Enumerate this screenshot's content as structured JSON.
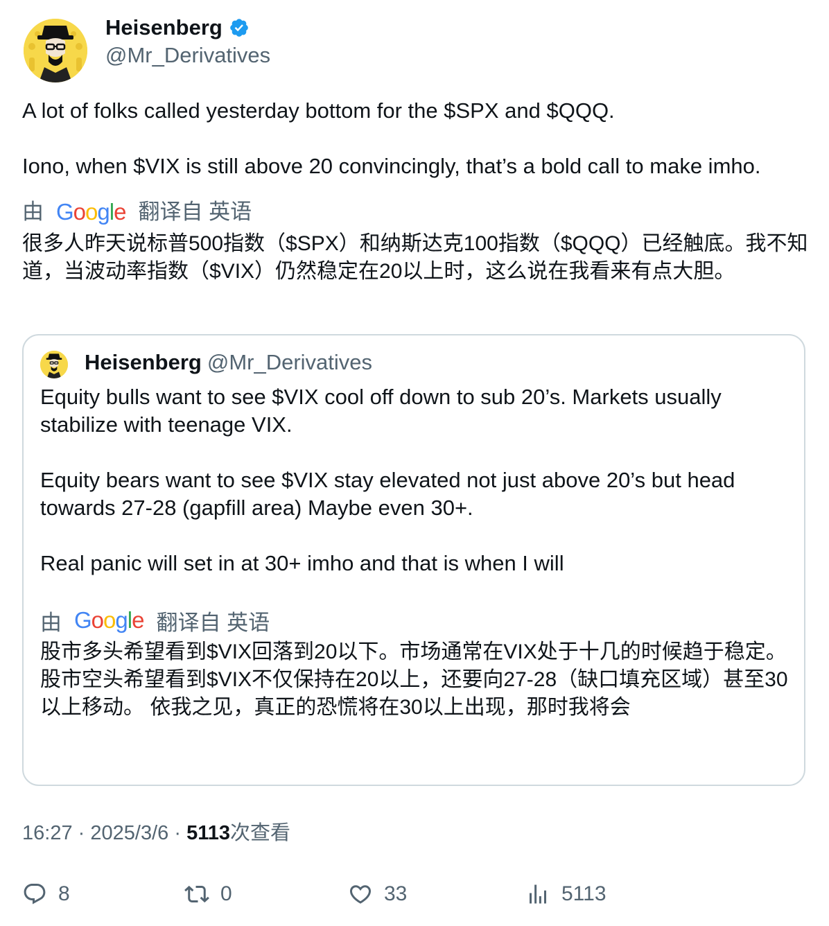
{
  "author": {
    "name": "Heisenberg",
    "handle": "@Mr_Derivatives",
    "verified": true
  },
  "tweet": {
    "paragraphs": [
      "A lot of folks called yesterday bottom for the $SPX and $QQQ.",
      "Iono, when $VIX is still above 20 convincingly, that’s a bold call to make imho."
    ],
    "translate_by": "由",
    "translate_logo": "Google",
    "translate_label": "翻译自 英语",
    "translated_text": "很多人昨天说标普500指数（$SPX）和纳斯达克100指数（$QQQ）已经触底。我不知道，当波动率指数（$VIX）仍然稳定在20以上时，这么说在我看来有点大胆。"
  },
  "quote": {
    "name": "Heisenberg",
    "handle": "@Mr_Derivatives",
    "paragraphs": [
      "Equity bulls want to see $VIX cool off down to sub 20’s. Markets usually stabilize with teenage VIX.",
      "Equity bears want to see $VIX stay elevated not just above 20’s but head towards 27-28 (gapfill area) Maybe even 30+.",
      "Real panic will set in at 30+ imho and that is when I will"
    ],
    "translate_by": "由",
    "translate_logo": "Google",
    "translate_label": "翻译自 英语",
    "translated_text": "股市多头希望看到$VIX回落到20以下。市场通常在VIX处于十几的时候趋于稳定。 股市空头希望看到$VIX不仅保持在20以上，还要向27-28（缺口填充区域）甚至30以上移动。 依我之见，真正的恐慌将在30以上出现，那时我将会"
  },
  "meta": {
    "time": "16:27",
    "separator": "·",
    "date": "2025/3/6",
    "views": "5113",
    "views_label": "次查看"
  },
  "actions": {
    "reply_count": "8",
    "retweet_count": "0",
    "like_count": "33",
    "views_count": "5113",
    "icons": [
      "reply-icon",
      "retweet-icon",
      "like-icon",
      "views-icon"
    ]
  },
  "colors": {
    "text": "#0f1419",
    "secondary": "#536471",
    "border": "#cfd9de",
    "verified": "#1d9bf0",
    "avatar_bg": "#f7d84a"
  }
}
